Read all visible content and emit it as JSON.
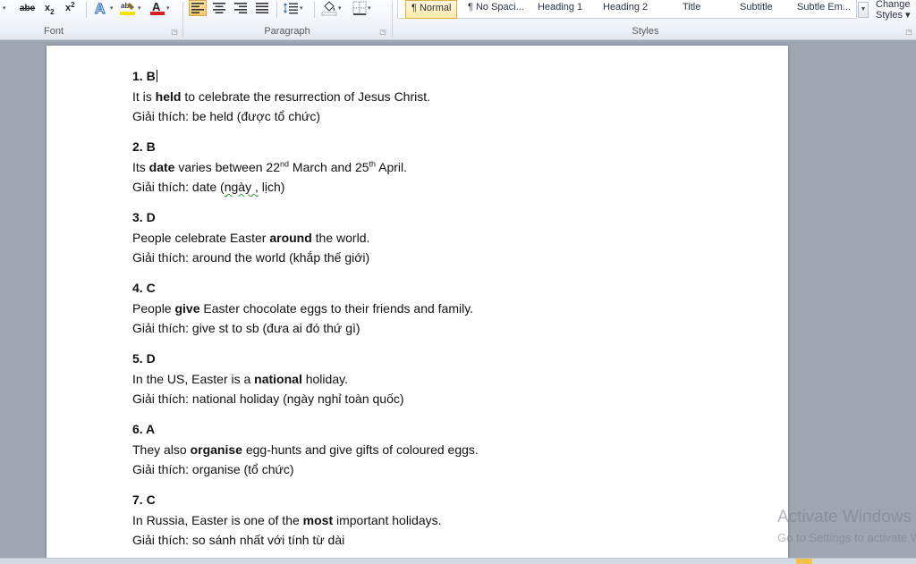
{
  "ribbon": {
    "font_group": {
      "label": "Font",
      "strikethrough": "abe",
      "subscript": "x",
      "subscript_mark": "2",
      "superscript": "x",
      "superscript_mark": "2"
    },
    "paragraph_group": {
      "label": "Paragraph"
    },
    "styles_group": {
      "label": "Styles",
      "items": [
        {
          "label": "¶ Normal"
        },
        {
          "label": "¶ No Spaci..."
        },
        {
          "label": "Heading 1"
        },
        {
          "label": "Heading 2"
        },
        {
          "label": "Title"
        },
        {
          "label": "Subtitle"
        },
        {
          "label": "Subtle Em..."
        }
      ],
      "change_styles_line1": "Change",
      "change_styles_line2": "Styles ▾"
    },
    "colors": {
      "highlight": "#f6e400",
      "font_color": "#d81e1e",
      "active_button": "#f8c86b"
    }
  },
  "document": {
    "items": [
      {
        "head": "1. B",
        "sentence": {
          "before": "It is ",
          "bold": "held",
          "after": " to celebrate the resurrection of Jesus Christ."
        },
        "explain": "Giải thích: be held (được tổ chức)"
      },
      {
        "head": "2. B",
        "sentence": {
          "before": "Its ",
          "bold": "date",
          "after": " varies between 22",
          "sup1": "nd",
          "mid": " March and 25",
          "sup2": "th",
          "end": " April."
        },
        "explain_before": "Giải thích: date (",
        "explain_squiggle": "ngày ,",
        "explain_after": " lịch)"
      },
      {
        "head": "3. D",
        "sentence": {
          "before": "People celebrate Easter ",
          "bold": "around",
          "after": " the world."
        },
        "explain": "Giải thích: around the world (khắp thế giới)"
      },
      {
        "head": "4. C",
        "sentence": {
          "before": "People ",
          "bold": "give",
          "after": " Easter chocolate eggs to their friends and family."
        },
        "explain": "Giải thích: give st to sb (đưa ai đó thứ gì)"
      },
      {
        "head": "5. D",
        "sentence": {
          "before": "In the US, Easter is a ",
          "bold": "national",
          "after": " holiday."
        },
        "explain": "Giải thích: national holiday (ngày nghỉ toàn quốc)"
      },
      {
        "head": "6. A",
        "sentence": {
          "before": "They also ",
          "bold": "organise",
          "after": " egg-hunts and give gifts of coloured eggs."
        },
        "explain": "Giải thích: organise (tổ chức)"
      },
      {
        "head": "7. C",
        "sentence": {
          "before": "In Russia, Easter is one of the ",
          "bold": "most",
          "after": " important holidays."
        },
        "explain": "Giải thích: so sánh nhất với tính từ dài"
      }
    ]
  },
  "watermark": {
    "title": "Activate Windows",
    "subtitle": "Go to Settings to activate Windows."
  }
}
